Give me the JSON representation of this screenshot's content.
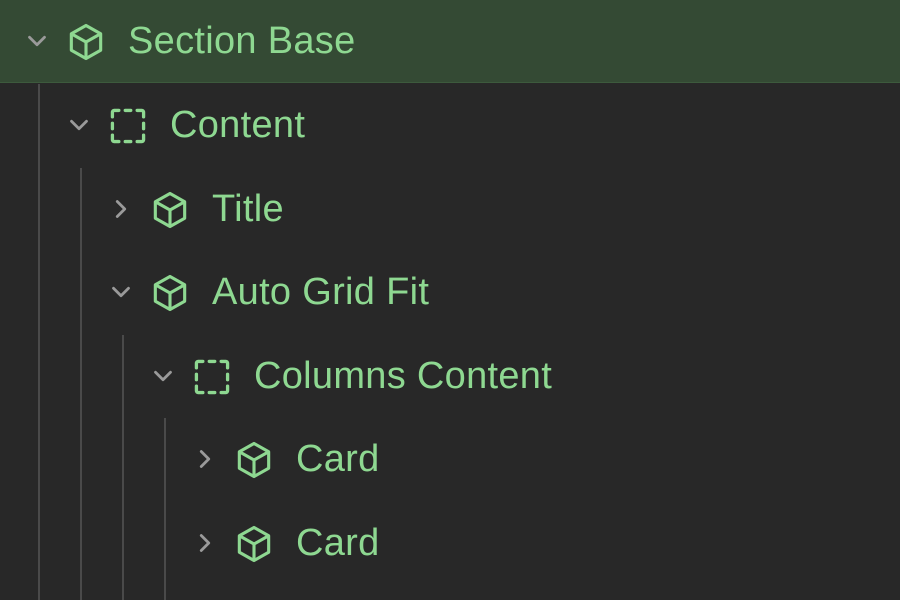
{
  "colors": {
    "background": "#282828",
    "selected_row": "#344a34",
    "accent": "#8ed891",
    "chevron": "#9a9a9a",
    "guide_line": "#4a4a4a"
  },
  "tree": {
    "nodes": [
      {
        "label": "Section Base",
        "icon": "cube-icon",
        "chevron": "chevron-down-icon",
        "expanded": true,
        "selected": true,
        "depth": 0
      },
      {
        "label": "Content",
        "icon": "frame-dashed-icon",
        "chevron": "chevron-down-icon",
        "expanded": true,
        "selected": false,
        "depth": 1
      },
      {
        "label": "Title",
        "icon": "cube-icon",
        "chevron": "chevron-right-icon",
        "expanded": false,
        "selected": false,
        "depth": 2
      },
      {
        "label": "Auto Grid Fit",
        "icon": "cube-icon",
        "chevron": "chevron-down-icon",
        "expanded": true,
        "selected": false,
        "depth": 2
      },
      {
        "label": "Columns Content",
        "icon": "frame-dashed-icon",
        "chevron": "chevron-down-icon",
        "expanded": true,
        "selected": false,
        "depth": 3
      },
      {
        "label": "Card",
        "icon": "cube-icon",
        "chevron": "chevron-right-icon",
        "expanded": false,
        "selected": false,
        "depth": 4
      },
      {
        "label": "Card",
        "icon": "cube-icon",
        "chevron": "chevron-right-icon",
        "expanded": false,
        "selected": false,
        "depth": 4
      }
    ]
  }
}
